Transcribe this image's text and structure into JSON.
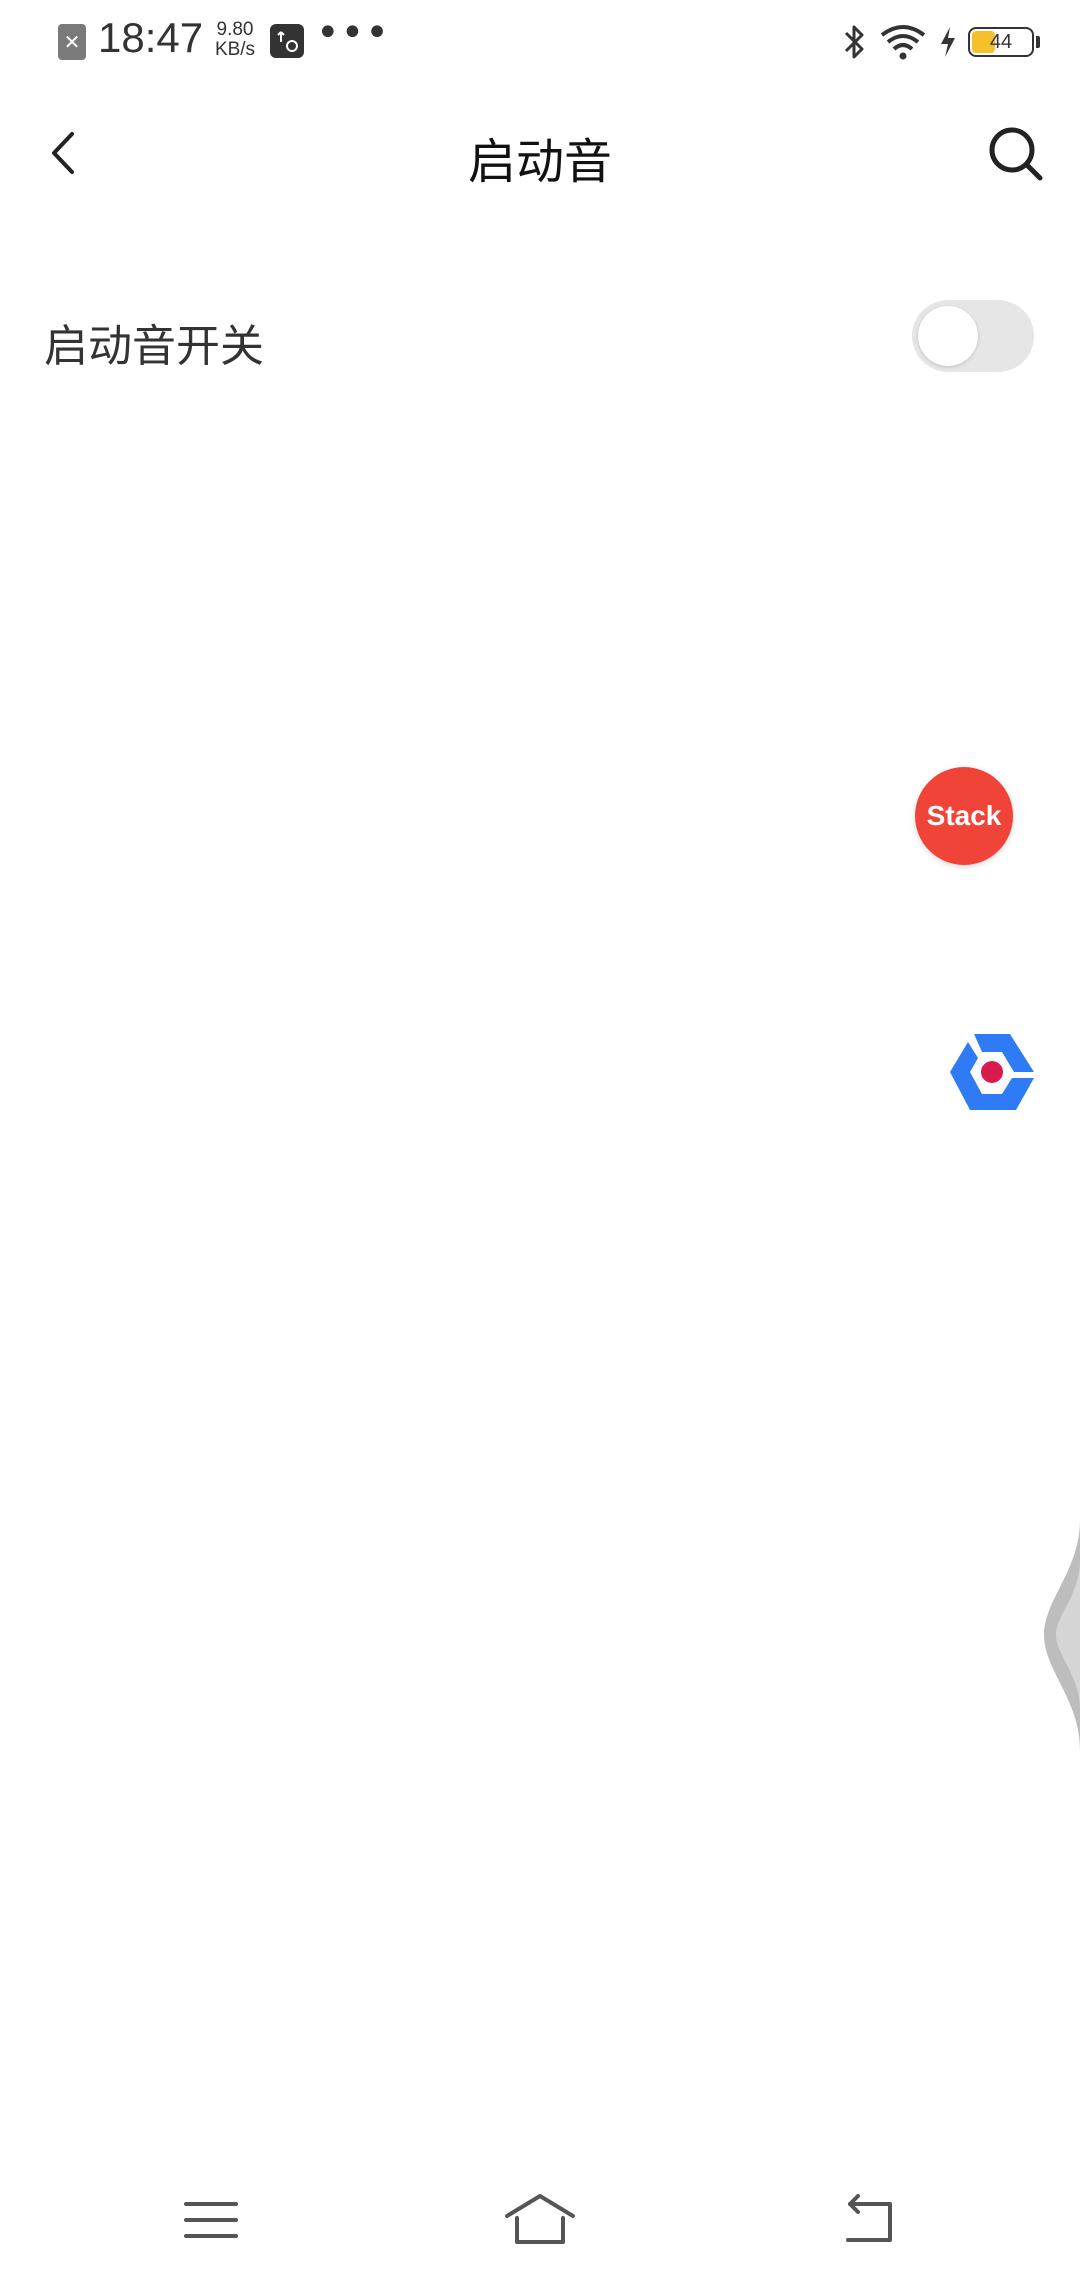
{
  "status_bar": {
    "time": "18:47",
    "net_speed_value": "9.80",
    "net_speed_unit": "KB/s",
    "more": "•••",
    "battery_level": "44",
    "battery_fraction": 0.44
  },
  "header": {
    "title": "启动音"
  },
  "settings": {
    "startup_sound_label": "启动音开关",
    "startup_sound_enabled": false
  },
  "floating": {
    "stack_label": "Stack"
  },
  "colors": {
    "stack_red": "#f04438",
    "logo_blue": "#2f7bf5",
    "logo_dot": "#d81b4f",
    "toggle_off_track": "#e6e6e6",
    "battery_fill": "#f5c12b"
  },
  "icons": {
    "back": "chevron-left-icon",
    "search": "search-icon",
    "nav_menu": "menu-icon",
    "nav_home": "home-icon",
    "nav_back": "return-icon"
  }
}
